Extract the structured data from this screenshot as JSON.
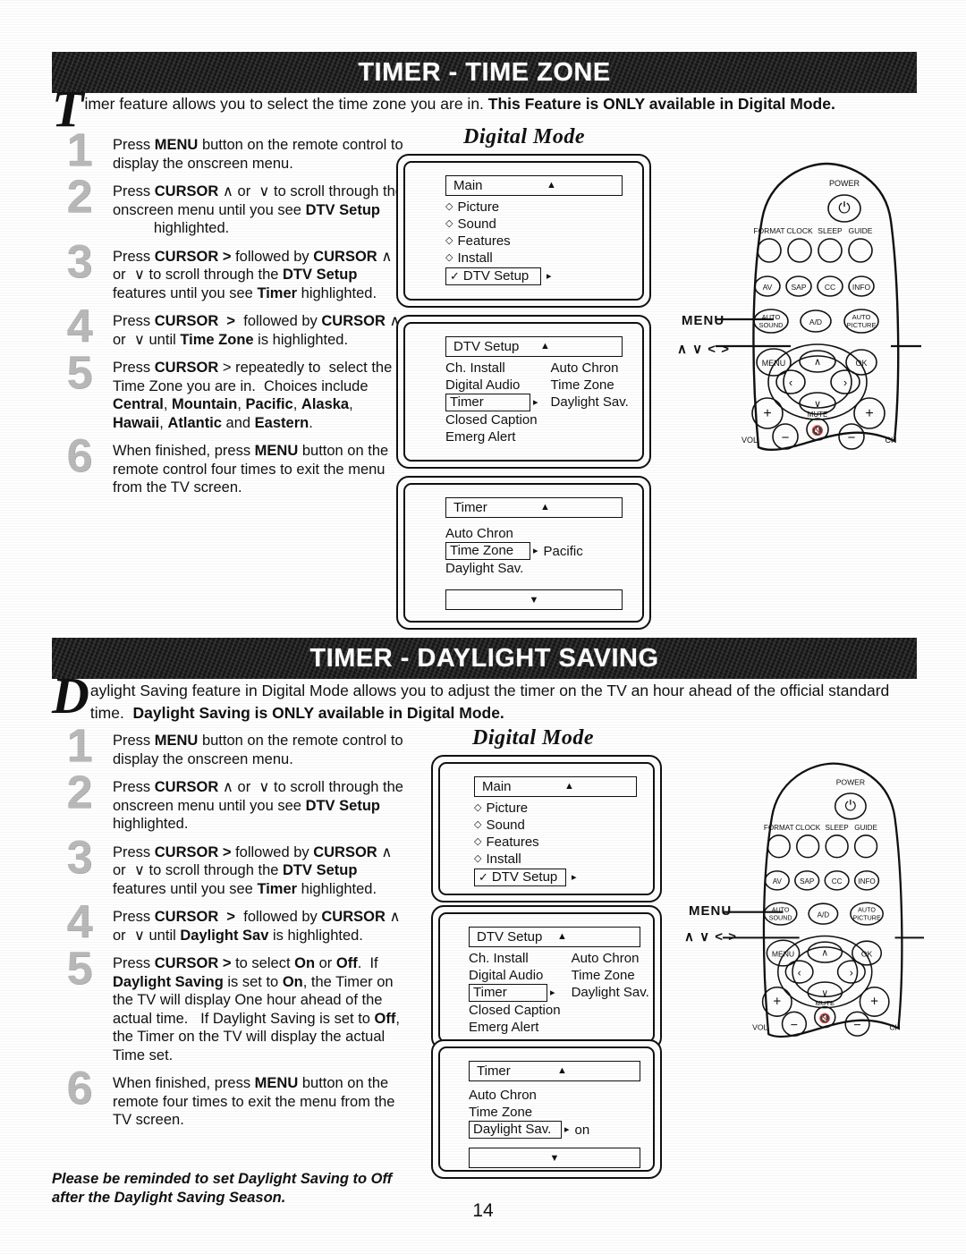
{
  "page": {
    "number": "14"
  },
  "sections": [
    {
      "banner_title": "TIMER - TIME ZONE",
      "intro_dropcap": "T",
      "intro_rest": "imer feature allows you to select the time zone you are in. ",
      "intro_bold": "This Feature is ONLY available in Digital Mode.",
      "digital_mode_caption": "Digital Mode",
      "steps": [
        {
          "num": "1",
          "html": "Press <b>MENU</b> button on the remote control to display the onscreen menu."
        },
        {
          "num": "2",
          "html": "Press <b>CURSOR</b> &#8743; or &nbsp;&#8744; to scroll through the onscreen menu until you see <b>DTV Setup</b> &nbsp;&nbsp;&nbsp;&nbsp;&nbsp;&nbsp;&nbsp;&nbsp;&nbsp; highlighted."
        },
        {
          "num": "3",
          "html": "Press <b>CURSOR &gt;</b> followed by <b>CURSOR</b> &#8743; or &nbsp;&#8744; to scroll through the <b>DTV Setup</b> features until you see <b>Timer</b> highlighted."
        },
        {
          "num": "4",
          "html": "Press <b>CURSOR &nbsp;&gt;</b> &nbsp;followed by <b>CURSOR</b> &#8743; or &nbsp;&#8744; until <b>Time Zone</b> is highlighted."
        },
        {
          "num": "5",
          "html": "Press <b>CURSOR</b> &gt; repeatedly to &nbsp;select the Time Zone you are in. &nbsp;Choices include <b>Central</b>, <b>Mountain</b>, <b>Pacific</b>, <b>Alaska</b>, <b>Hawaii</b>, <b>Atlantic</b> and <b>Eastern</b>."
        },
        {
          "num": "6",
          "html": "When finished, press <b>MENU</b> button on the remote control four times to exit the menu from the TV screen."
        }
      ],
      "screens": [
        {
          "title": "Main",
          "title_arrow": "▲",
          "rows": [
            {
              "bullet": "◇",
              "label": "Picture"
            },
            {
              "bullet": "◇",
              "label": "Sound"
            },
            {
              "bullet": "◇",
              "label": "Features"
            },
            {
              "bullet": "◇",
              "label": "Install"
            }
          ],
          "highlight": {
            "check": "✓",
            "label": "DTV Setup",
            "arrow": "▸"
          }
        },
        {
          "title": "DTV Setup",
          "title_arrow": "▲",
          "left_rows": [
            "Ch. Install",
            "Digital Audio"
          ],
          "highlight": {
            "label": "Timer",
            "arrow": "▸"
          },
          "left_rows_after": [
            "Closed Caption",
            "Emerg Alert"
          ],
          "right_rows": [
            "Auto Chron",
            "Time Zone",
            "Daylight Sav."
          ]
        },
        {
          "title": "Timer",
          "title_arrow": "▲",
          "rows": [
            "Auto Chron"
          ],
          "highlight": {
            "label": "Time Zone",
            "arrow": "▸",
            "value": "Pacific"
          },
          "rows_after": [
            "Daylight Sav."
          ],
          "bottom_arrow": "▼"
        }
      ],
      "remote_labels": {
        "menu": "MENU",
        "cursor": "∧ ∨ < >"
      }
    },
    {
      "banner_title": "TIMER - DAYLIGHT SAVING",
      "intro_dropcap": "D",
      "intro_rest": "aylight Saving feature in Digital Mode allows you to adjust the timer on the TV an hour ahead of the official standard time. &nbsp;",
      "intro_bold": "Daylight Saving is ONLY available in Digital Mode.",
      "digital_mode_caption": "Digital Mode",
      "steps": [
        {
          "num": "1",
          "html": "Press <b>MENU</b> button on the remote control to display the onscreen menu."
        },
        {
          "num": "2",
          "html": "Press <b>CURSOR</b> &#8743; or &nbsp;&#8744; to scroll through the onscreen menu until you see <b>DTV Setup</b> highlighted."
        },
        {
          "num": "3",
          "html": "Press <b>CURSOR &gt;</b> followed by <b>CURSOR</b> &#8743; or &nbsp;&#8744; to scroll through the <b>DTV Setup</b> features until you see <b>Timer</b> highlighted."
        },
        {
          "num": "4",
          "html": "Press <b>CURSOR &nbsp;&gt;</b> &nbsp;followed by <b>CURSOR</b> &#8743; or &nbsp;&#8744; until <b>Daylight Sav</b> is highlighted."
        },
        {
          "num": "5",
          "html": "Press <b>CURSOR &gt;</b> to select <b>On</b> or <b>Off</b>. &nbsp;If <b>Daylight Saving</b> is set to <b>On</b>, the Timer on the TV will display One hour ahead of the actual time. &nbsp;&nbsp;If Daylight Saving is set to <b>Off</b>, the Timer on the TV will display the actual Time set."
        },
        {
          "num": "6",
          "html": "When finished, press <b>MENU</b> button on the remote four times to exit the menu from the TV screen."
        }
      ],
      "note": "Please be reminded to set Daylight Saving to Off after the Daylight Saving Season.",
      "screens": [
        {
          "title": "Main",
          "title_arrow": "▲",
          "rows": [
            {
              "bullet": "◇",
              "label": "Picture"
            },
            {
              "bullet": "◇",
              "label": "Sound"
            },
            {
              "bullet": "◇",
              "label": "Features"
            },
            {
              "bullet": "◇",
              "label": "Install"
            }
          ],
          "highlight": {
            "check": "✓",
            "label": "DTV Setup",
            "arrow": "▸"
          }
        },
        {
          "title": "DTV Setup",
          "title_arrow": "▲",
          "left_rows": [
            "Ch. Install",
            "Digital Audio"
          ],
          "highlight": {
            "label": "Timer",
            "arrow": "▸"
          },
          "left_rows_after": [
            "Closed Caption",
            "Emerg Alert"
          ],
          "right_rows": [
            "Auto Chron",
            "Time Zone",
            "Daylight Sav."
          ]
        },
        {
          "title": "Timer",
          "title_arrow": "▲",
          "rows": [
            "Auto Chron",
            "Time Zone"
          ],
          "highlight": {
            "label": "Daylight Sav.",
            "arrow": "▸",
            "value": "on"
          },
          "rows_after": [],
          "bottom_arrow": "▼"
        }
      ],
      "remote_labels": {
        "menu": "MENU",
        "cursor": "∧ ∨ < >"
      }
    }
  ],
  "remote": {
    "power_label": "POWER",
    "power_glyph": "⏻",
    "row1": [
      "FORMAT",
      "CLOCK",
      "SLEEP",
      "GUIDE"
    ],
    "row2": [
      "AV",
      "SAP",
      "CC",
      "INFO"
    ],
    "row3": [
      "AUTO SOUND",
      "A/D",
      "AUTO PICTURE"
    ],
    "menu_button": "MENU",
    "ok_button": "OK",
    "up_glyph": "∧",
    "down_glyph": "∨",
    "left_glyph": "‹",
    "right_glyph": "›",
    "mute_label": "MUTE",
    "mute_glyph": "♩",
    "vol_label": "VOL",
    "ch_label": "CH",
    "plus": "+",
    "minus": "−"
  }
}
